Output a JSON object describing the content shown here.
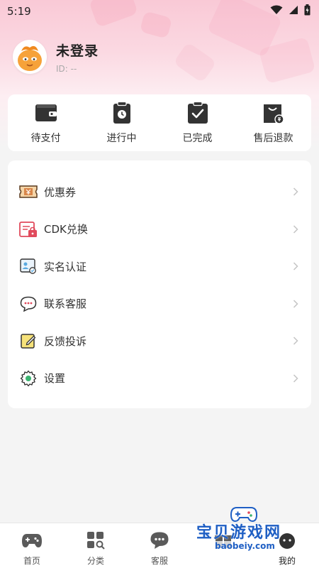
{
  "status_bar": {
    "time": "5:19"
  },
  "profile": {
    "username": "未登录",
    "user_id": "ID: --"
  },
  "orders": [
    {
      "label": "待支付",
      "icon": "wallet-icon"
    },
    {
      "label": "进行中",
      "icon": "clock-clipboard-icon"
    },
    {
      "label": "已完成",
      "icon": "check-clipboard-icon"
    },
    {
      "label": "售后退款",
      "icon": "refund-bag-icon"
    }
  ],
  "menu": [
    {
      "label": "优惠券",
      "icon": "coupon-icon"
    },
    {
      "label": "CDK兑换",
      "icon": "cdk-icon"
    },
    {
      "label": "实名认证",
      "icon": "id-card-icon"
    },
    {
      "label": "联系客服",
      "icon": "chat-bubble-icon"
    },
    {
      "label": "反馈投诉",
      "icon": "feedback-edit-icon"
    },
    {
      "label": "设置",
      "icon": "gear-icon"
    }
  ],
  "tabs": [
    {
      "label": "首页",
      "icon": "gamepad-icon"
    },
    {
      "label": "分类",
      "icon": "grid-search-icon"
    },
    {
      "label": "客服",
      "icon": "chat-icon"
    },
    {
      "label": "",
      "icon": "gift-icon"
    },
    {
      "label": "我的",
      "icon": "profile-icon",
      "active": true
    }
  ],
  "watermark": {
    "text": "宝贝游戏网",
    "url": "baobeiy.com"
  },
  "colors": {
    "accent": "#e14a5c",
    "brand_blue": "#1f5fc4",
    "hero_pink": "#f9c9d6"
  }
}
